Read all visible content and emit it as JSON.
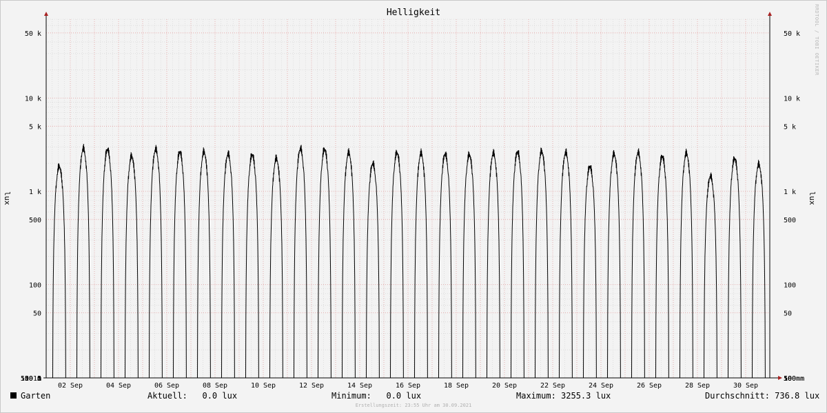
{
  "title": "Helligkeit",
  "watermark": "RRDTOOL / TOBI OETIKER",
  "y_label": "lux",
  "legend": {
    "series_name": "Garten",
    "current": "Aktuell:   0.0 lux",
    "minimum": "Minimum:   0.0 lux",
    "maximum": "Maximum: 3255.3 lux",
    "average": "Durchschnitt: 736.8 lux"
  },
  "footer": "Erstellungszeit: 23:55 Uhr am 30.09.2021",
  "colors": {
    "series": "#000000",
    "major_grid": "#e6a0a0",
    "minor_grid": "#d0d0d0",
    "axis": "#000000",
    "arrow": "#aa2222"
  },
  "chart_data": {
    "type": "line",
    "title": "Helligkeit",
    "ylabel": "lux",
    "scale": "log",
    "ylim": [
      10,
      70000
    ],
    "xlim": [
      "2021-09-01",
      "2021-10-01"
    ],
    "grid": true,
    "legend": "bottom-left",
    "y_ticks": [
      {
        "value": 10,
        "label": "10 m"
      },
      {
        "value": 50,
        "label": "50 m"
      },
      {
        "value": 100,
        "label": "100 m"
      },
      {
        "value": 500,
        "label": "500 m"
      },
      {
        "value": 1000,
        "label": "1"
      },
      {
        "value": 5000,
        "label": "5"
      },
      {
        "value": 10000,
        "label": "10"
      },
      {
        "value": 50000,
        "label": "50"
      },
      {
        "value": 100000,
        "label": "100"
      },
      {
        "value": 500000,
        "label": "500"
      },
      {
        "value": 1000000,
        "label": "1 k"
      },
      {
        "value": 5000000,
        "label": "5 k"
      },
      {
        "value": 10000000,
        "label": "10 k"
      },
      {
        "value": 50000000,
        "label": "50 k"
      }
    ],
    "x_ticks": [
      "02 Sep",
      "04 Sep",
      "06 Sep",
      "08 Sep",
      "10 Sep",
      "12 Sep",
      "14 Sep",
      "16 Sep",
      "18 Sep",
      "20 Sep",
      "22 Sep",
      "24 Sep",
      "26 Sep",
      "28 Sep",
      "30 Sep"
    ],
    "series": [
      {
        "name": "Garten",
        "daily_peaks_lux": [
          2100,
          3250,
          3200,
          2700,
          3200,
          3000,
          3000,
          2850,
          2800,
          2550,
          3250,
          3200,
          2950,
          2250,
          2950,
          2900,
          2850,
          2800,
          2900,
          3000,
          3050,
          2950,
          2100,
          2850,
          2950,
          2700,
          2900,
          1650,
          2550,
          2200
        ]
      }
    ]
  }
}
